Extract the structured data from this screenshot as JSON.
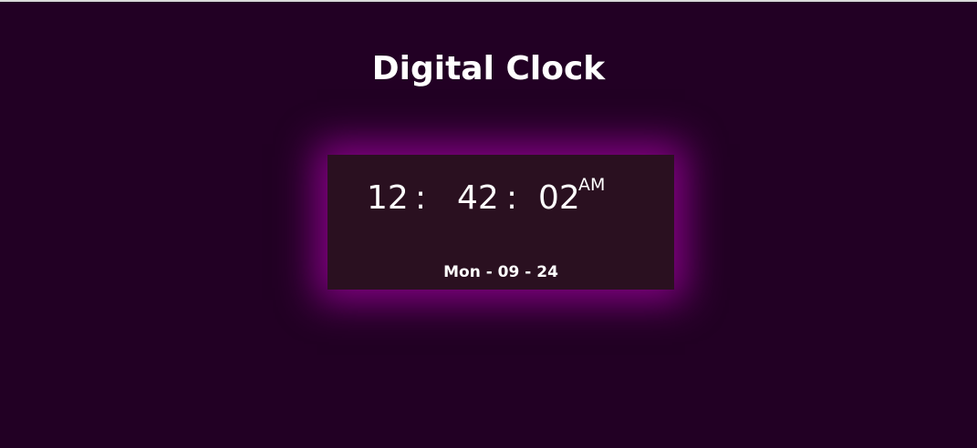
{
  "page": {
    "title": "Digital Clock",
    "background_color": "#220024",
    "accent_glow_color": "#aa00aa"
  },
  "clock": {
    "hours": "12",
    "minutes": "42",
    "seconds": "02",
    "separator": ":",
    "meridiem": "AM",
    "date": "Mon - 09 - 24"
  }
}
